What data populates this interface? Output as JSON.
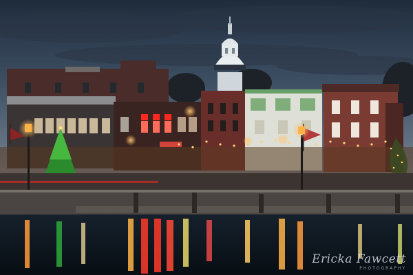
{
  "image": {
    "kind": "photograph",
    "subject": "harbor waterfront at dusk with illuminated storefronts and domed tower reflected in water"
  },
  "watermark": {
    "signature": "Ericka Fawcett",
    "subtitle": "PHOTOGRAPHY"
  },
  "signs": {
    "red_storefront": "",
    "awning": ""
  },
  "palette": {
    "sky_top": "#2b3a4d",
    "sky_bottom": "#6f7e90",
    "water": "#0b141c",
    "brick": "#5a2f2a",
    "light_warm": "#ffb347",
    "light_red": "#ff3a2a",
    "tree_green": "#3fae3a"
  }
}
